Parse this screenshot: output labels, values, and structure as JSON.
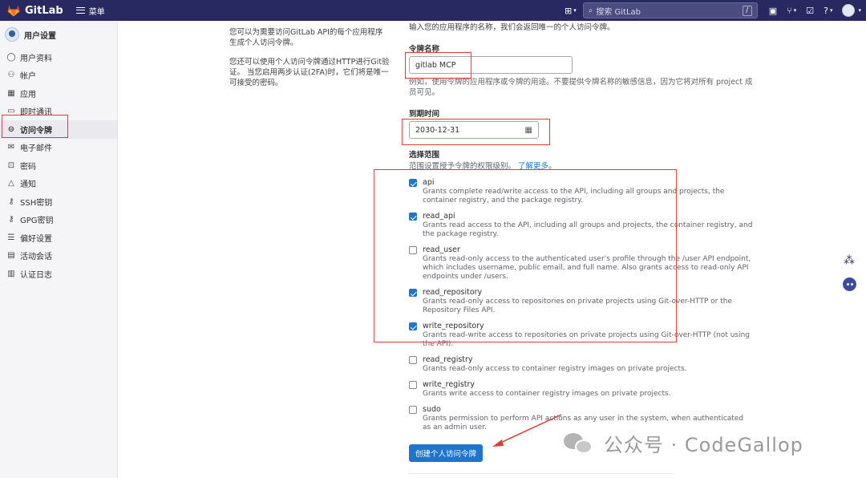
{
  "navbar": {
    "brand": "GitLab",
    "menu_label": "菜单",
    "search_placeholder": "搜索 GitLab",
    "search_shortcut": "/"
  },
  "sidebar": {
    "title": "用户设置",
    "items": [
      {
        "label": "用户资料",
        "icon": "user-icon"
      },
      {
        "label": "帐户",
        "icon": "account-icon"
      },
      {
        "label": "应用",
        "icon": "applications-icon"
      },
      {
        "label": "即时通讯",
        "icon": "chat-icon"
      },
      {
        "label": "访问令牌",
        "icon": "token-icon",
        "active": true
      },
      {
        "label": "电子邮件",
        "icon": "mail-icon"
      },
      {
        "label": "密码",
        "icon": "lock-icon"
      },
      {
        "label": "通知",
        "icon": "bell-icon"
      },
      {
        "label": "SSH密钥",
        "icon": "key-icon"
      },
      {
        "label": "GPG密钥",
        "icon": "key-icon"
      },
      {
        "label": "偏好设置",
        "icon": "preferences-icon"
      },
      {
        "label": "活动会话",
        "icon": "sessions-icon"
      },
      {
        "label": "认证日志",
        "icon": "log-icon"
      }
    ]
  },
  "description": {
    "p1": "您可以为需要访问GitLab API的每个应用程序生成个人访问令牌。",
    "p2": "您还可以使用个人访问令牌通过HTTP进行Git验证。 当您启用两步认证(2FA)时，它们将是唯一可接受的密码。"
  },
  "form": {
    "intro": "输入您的应用程序的名称，我们会返回唯一的个人访问令牌。",
    "name_label": "令牌名称",
    "name_value": "gitlab MCP",
    "name_help": "例如，使用令牌的应用程序或令牌的用途。不要提供令牌名称的敏感信息，因为它将对所有 project 成员可见。",
    "expiry_label": "到期时间",
    "expiry_value": "2030-12-31",
    "scopes_label": "选择范围",
    "scopes_help": "范围设置授予令牌的权限级别。",
    "scopes_link": "了解更多",
    "scopes_help_end": "。",
    "submit_label": "创建个人访问令牌"
  },
  "scopes": [
    {
      "name": "api",
      "checked": true,
      "desc": "Grants complete read/write access to the API, including all groups and projects, the container registry, and the package registry."
    },
    {
      "name": "read_api",
      "checked": true,
      "desc": "Grants read access to the API, including all groups and projects, the container registry, and the package registry."
    },
    {
      "name": "read_user",
      "checked": false,
      "desc": "Grants read-only access to the authenticated user's profile through the /user API endpoint, which includes username, public email, and full name. Also grants access to read-only API endpoints under /users."
    },
    {
      "name": "read_repository",
      "checked": true,
      "desc": "Grants read-only access to repositories on private projects using Git-over-HTTP or the Repository Files API."
    },
    {
      "name": "write_repository",
      "checked": true,
      "desc": "Grants read-write access to repositories on private projects using Git-over-HTTP (not using the API)."
    },
    {
      "name": "read_registry",
      "checked": false,
      "desc": "Grants read-only access to container registry images on private projects."
    },
    {
      "name": "write_registry",
      "checked": false,
      "desc": "Grants write access to container registry images on private projects."
    },
    {
      "name": "sudo",
      "checked": false,
      "desc": "Grants permission to perform API actions as any user in the system, when authenticated as an admin user."
    }
  ],
  "watermark": {
    "text": "公众号 · CodeGallop"
  },
  "colors": {
    "navbar": "#292961",
    "primary": "#1f75cb",
    "annotation": "#e23b3b"
  }
}
